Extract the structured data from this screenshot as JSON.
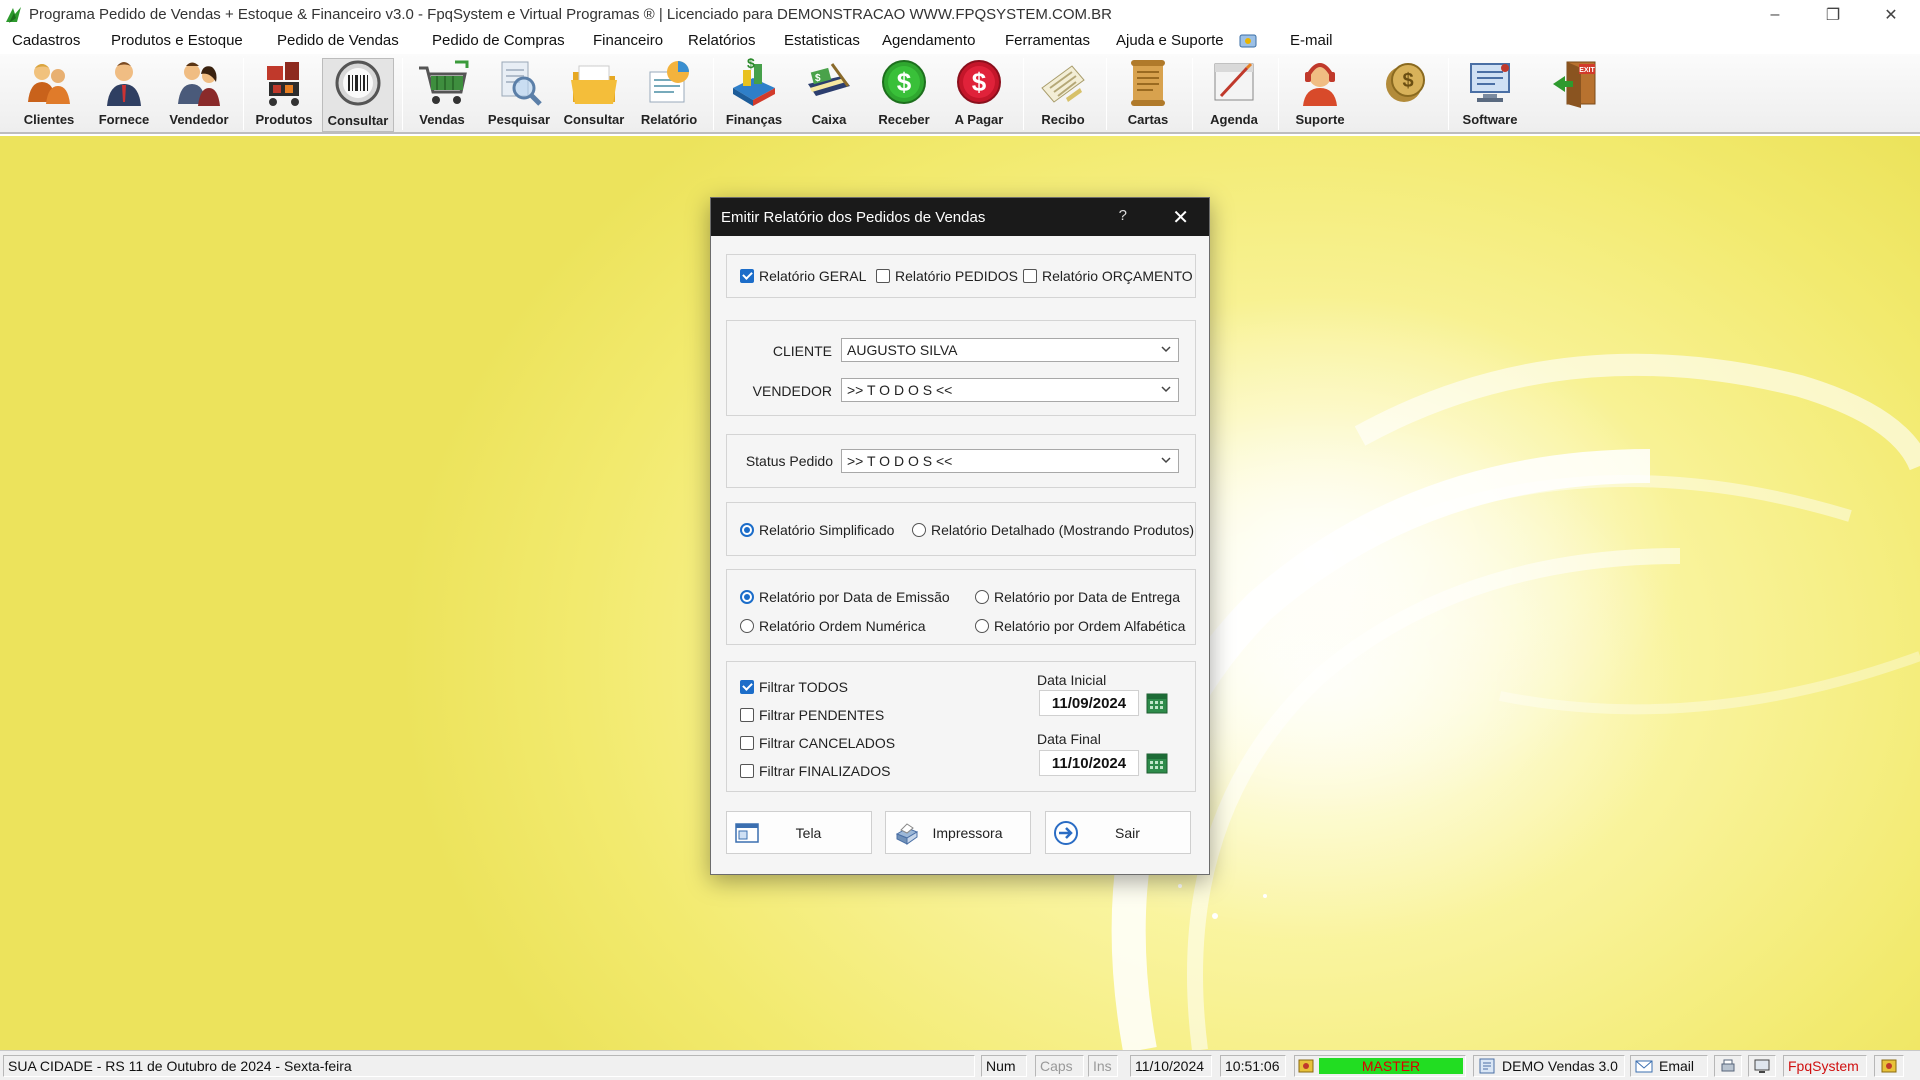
{
  "window": {
    "title": "Programa Pedido de Vendas + Estoque & Financeiro v3.0 - FpqSystem e Virtual Programas ® | Licenciado para  DEMONSTRACAO WWW.FPQSYSTEM.COM.BR",
    "controls": [
      "minimize-icon",
      "restore-icon",
      "close-icon"
    ]
  },
  "menu": [
    {
      "label": "Cadastros"
    },
    {
      "label": "Produtos e Estoque"
    },
    {
      "label": "Pedido de Vendas"
    },
    {
      "label": "Pedido de Compras"
    },
    {
      "label": "Financeiro"
    },
    {
      "label": "Relatórios"
    },
    {
      "label": "Estatisticas"
    },
    {
      "label": "Agendamento"
    },
    {
      "label": "Ferramentas"
    },
    {
      "label": "Ajuda e Suporte"
    },
    {
      "label": "E-mail"
    }
  ],
  "toolbar": [
    {
      "label": "Clientes",
      "icon": "clients-icon"
    },
    {
      "label": "Fornece",
      "icon": "supplier-icon"
    },
    {
      "label": "Vendedor",
      "icon": "seller-icon"
    },
    {
      "label": "Produtos",
      "icon": "products-icon"
    },
    {
      "label": "Consultar",
      "icon": "barcode-icon"
    },
    {
      "label": "Vendas",
      "icon": "cart-icon"
    },
    {
      "label": "Pesquisar",
      "icon": "search-icon"
    },
    {
      "label": "Consultar",
      "icon": "folder-icon"
    },
    {
      "label": "Relatório",
      "icon": "report-icon"
    },
    {
      "label": "Finanças",
      "icon": "finance-icon"
    },
    {
      "label": "Caixa",
      "icon": "cashbox-icon"
    },
    {
      "label": "Receber",
      "icon": "receive-icon"
    },
    {
      "label": "A Pagar",
      "icon": "pay-icon"
    },
    {
      "label": "Recibo",
      "icon": "receipt-icon"
    },
    {
      "label": "Cartas",
      "icon": "letters-icon"
    },
    {
      "label": "Agenda",
      "icon": "agenda-icon"
    },
    {
      "label": "Suporte",
      "icon": "support-icon"
    },
    {
      "label": "",
      "icon": "coins-icon"
    },
    {
      "label": "Software",
      "icon": "software-icon"
    },
    {
      "label": "",
      "icon": "exit-icon"
    }
  ],
  "dialog": {
    "title": "Emitir Relatório dos Pedidos de Vendas",
    "help": "?",
    "report_types": [
      {
        "label": "Relatório GERAL",
        "checked": true
      },
      {
        "label": "Relatório PEDIDOS",
        "checked": false
      },
      {
        "label": "Relatório ORÇAMENTO",
        "checked": false
      }
    ],
    "cliente_label": "CLIENTE",
    "cliente_value": "AUGUSTO SILVA",
    "vendedor_label": "VENDEDOR",
    "vendedor_value": ">> T O D O S <<",
    "status_label": "Status Pedido",
    "status_value": ">> T O D O S <<",
    "detail_options": [
      {
        "label": "Relatório Simplificado",
        "selected": true
      },
      {
        "label": "Relatório Detalhado (Mostrando Produtos)",
        "selected": false
      }
    ],
    "order_options": [
      {
        "label": "Relatório por Data de Emissão",
        "selected": true
      },
      {
        "label": "Relatório por Data de Entrega",
        "selected": false
      },
      {
        "label": "Relatório Ordem Numérica",
        "selected": false
      },
      {
        "label": "Relatório por Ordem Alfabética",
        "selected": false
      }
    ],
    "filters": [
      {
        "label": "Filtrar TODOS",
        "checked": true
      },
      {
        "label": "Filtrar PENDENTES",
        "checked": false
      },
      {
        "label": "Filtrar CANCELADOS",
        "checked": false
      },
      {
        "label": "Filtrar FINALIZADOS",
        "checked": false
      }
    ],
    "data_inicial_label": "Data Inicial",
    "data_inicial": "11/09/2024",
    "data_final_label": "Data Final",
    "data_final": "11/10/2024",
    "buttons": {
      "tela": "Tela",
      "impressora": "Impressora",
      "sair": "Sair"
    }
  },
  "statusbar": {
    "location_date": "SUA CIDADE - RS 11 de Outubro de 2024 - Sexta-feira",
    "num": "Num",
    "caps": "Caps",
    "ins": "Ins",
    "date": "11/10/2024",
    "time": "10:51:06",
    "user": "MASTER",
    "version": "DEMO Vendas 3.0",
    "email": "Email",
    "brand": "FpqSystem"
  },
  "colors": {
    "dialog_title_bg": "#1a1a1a",
    "accent_blue": "#1c6dc9",
    "user_badge_green": "#22dd22",
    "brand_red": "#d01010",
    "desktop_yellow": "#f5ee7a"
  }
}
